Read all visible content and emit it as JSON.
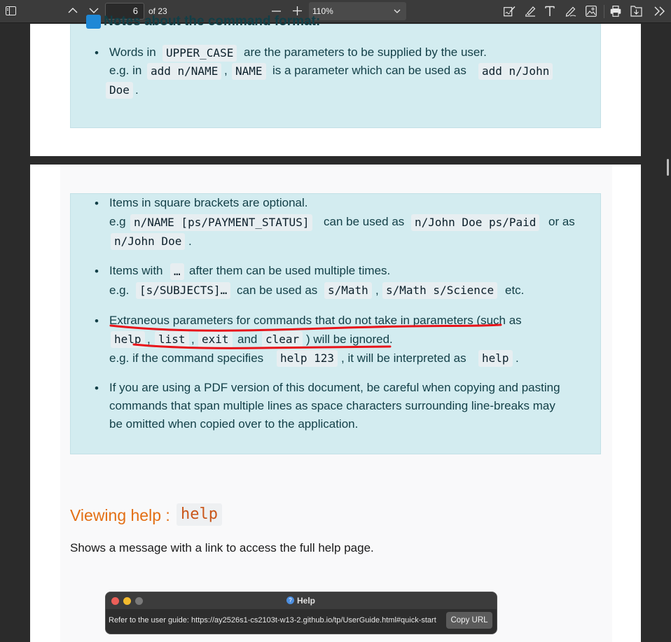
{
  "toolbar": {
    "page_current": "6",
    "page_total": "of 23",
    "zoom": "110%"
  },
  "notes_top": {
    "heading": "Notes about the command format:",
    "b1_text1": "Words in",
    "b1_code1": "UPPER_CASE",
    "b1_text2": "are the parameters to be supplied by the user.",
    "b1_text3": "e.g. in",
    "b1_code2": "add n/NAME",
    "b1_comma": ",",
    "b1_code3": "NAME",
    "b1_text4": "is a parameter which can be used as",
    "b1_code4": "add n/John",
    "b1_code5": "Doe",
    "b1_dot": "."
  },
  "notes": {
    "b2_text1": "Items in square brackets are optional.",
    "b2_text2": "e.g",
    "b2_code1": "n/NAME [ps/PAYMENT_STATUS]",
    "b2_text3": "can be used as",
    "b2_code2": "n/John Doe ps/Paid",
    "b2_text4": "or as",
    "b2_code3": "n/John Doe",
    "b2_dot": ".",
    "b3_text1": "Items with",
    "b3_code1": "…",
    "b3_text2": "after them can be used multiple times.",
    "b3_text3": "e.g.",
    "b3_code2": "[s/SUBJECTS]…",
    "b3_text4": "can be used as",
    "b3_code3": "s/Math",
    "b3_comma": ",",
    "b3_code4": "s/Math s/Science",
    "b3_text5": "etc.",
    "b4_text1": "Extraneous parameters for commands that do not take in parameters (such as",
    "b4_code1": "help",
    "b4_c1": ",",
    "b4_code2": "list",
    "b4_c2": ",",
    "b4_code3": "exit",
    "b4_and": "and",
    "b4_code4": "clear",
    "b4_text2": ") will be ignored.",
    "b4_text3": "e.g. if the command specifies",
    "b4_code5": "help 123",
    "b4_text4": ", it will be interpreted as",
    "b4_code6": "help",
    "b4_dot": ".",
    "b5_line1": "If you are using a PDF version of this document, be careful when copying and pasting",
    "b5_line2": "commands that span multiple lines as space characters surrounding line-breaks may",
    "b5_line3": "be omitted when copied over to the application."
  },
  "section": {
    "heading": "Viewing help :",
    "heading_code": "help",
    "description": "Shows a message with a link to access the full help page."
  },
  "dialog": {
    "title": "Help",
    "message": "Refer to the user guide: https://ay2526s1-cs2103t-w13-2.github.io/tp/UserGuide.html#quick-start",
    "copy_label": "Copy URL"
  },
  "colors": {
    "accent_heading": "#e36f14",
    "callout_bg": "#d3ecf0",
    "annotation": "#e8141a"
  }
}
